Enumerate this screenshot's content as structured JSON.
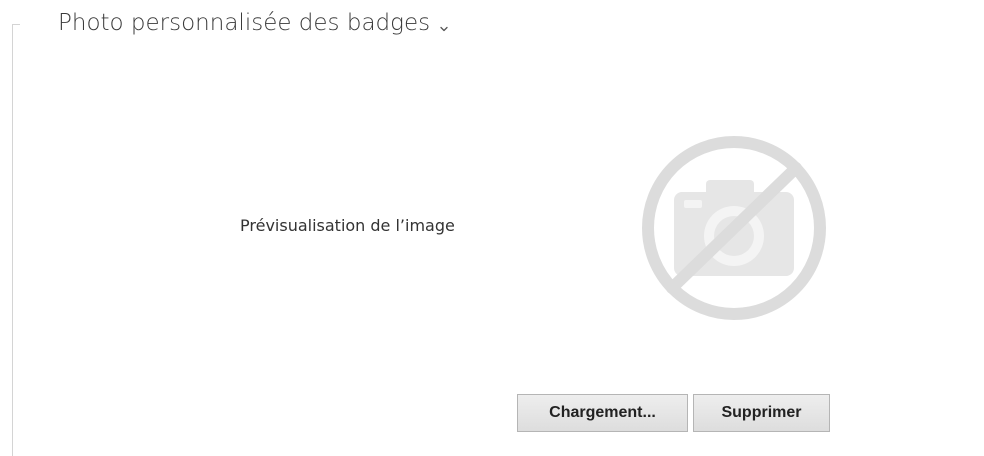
{
  "section": {
    "title": "Photo personnalisée des badges",
    "toggle_icon": "chevron-down-icon"
  },
  "preview": {
    "label": "Prévisualisation de l’image",
    "placeholder_icon": "no-photo-icon",
    "placeholder_color": "#dcdcdc"
  },
  "actions": {
    "upload_label": "Chargement...",
    "delete_label": "Supprimer"
  },
  "colors": {
    "frame_line": "#d4d4d4",
    "button_border": "#b5b5b5"
  }
}
